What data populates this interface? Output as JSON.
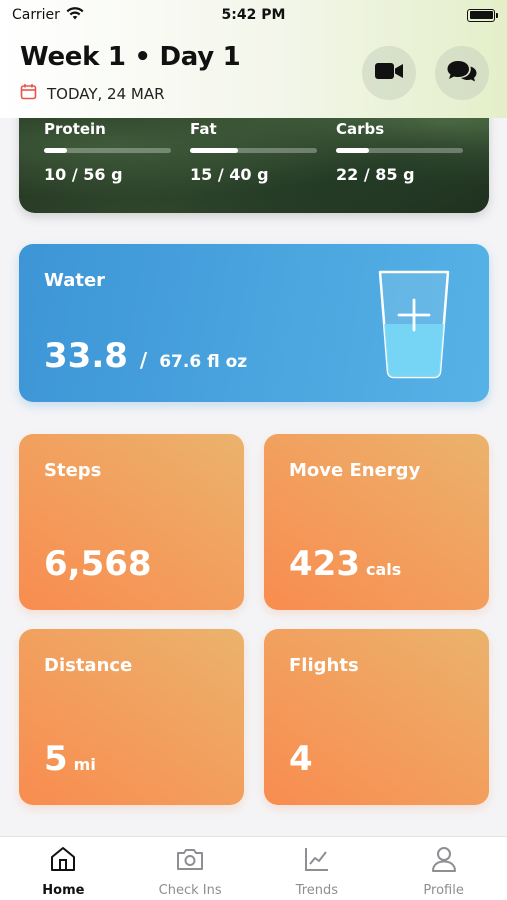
{
  "status_bar": {
    "carrier": "Carrier",
    "time": "5:42 PM"
  },
  "header": {
    "title": "Week 1 • Day 1",
    "date": "TODAY, 24 MAR",
    "video_icon": "video-camera-icon",
    "chat_icon": "chat-bubbles-icon",
    "calendar_icon": "calendar-icon"
  },
  "macros": [
    {
      "label": "Protein",
      "value": "10 / 56 g",
      "progress": 0.18
    },
    {
      "label": "Fat",
      "value": "15 / 40 g",
      "progress": 0.375
    },
    {
      "label": "Carbs",
      "value": "22 / 85 g",
      "progress": 0.26
    }
  ],
  "water": {
    "label": "Water",
    "current": "33.8",
    "separator": "/",
    "goal": "67.6 fl oz",
    "icon": "water-glass-plus-icon",
    "fill_level": 0.5
  },
  "activity": {
    "steps": {
      "label": "Steps",
      "value": "6,568"
    },
    "move_energy": {
      "label": "Move Energy",
      "value": "423",
      "unit": "cals"
    },
    "distance": {
      "label": "Distance",
      "value": "5",
      "unit": "mi"
    },
    "flights": {
      "label": "Flights",
      "value": "4"
    }
  },
  "tabs": [
    {
      "label": "Home",
      "icon": "home-icon",
      "active": true
    },
    {
      "label": "Check Ins",
      "icon": "camera-icon",
      "active": false
    },
    {
      "label": "Trends",
      "icon": "chart-icon",
      "active": false
    },
    {
      "label": "Profile",
      "icon": "person-icon",
      "active": false
    }
  ],
  "colors": {
    "water_accent": "#3d95d6",
    "activity_accent": "#f88c4f",
    "calendar_icon": "#e8574e"
  }
}
